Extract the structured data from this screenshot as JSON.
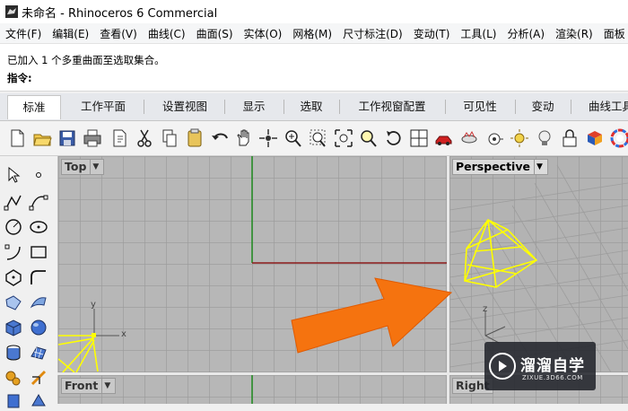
{
  "window": {
    "title": "未命名 - Rhinoceros 6 Commercial"
  },
  "menu": [
    "文件(F)",
    "编辑(E)",
    "查看(V)",
    "曲线(C)",
    "曲面(S)",
    "实体(O)",
    "网格(M)",
    "尺寸标注(D)",
    "变动(T)",
    "工具(L)",
    "分析(A)",
    "渲染(R)",
    "面板"
  ],
  "command": {
    "history_message": "已加入 1 个多重曲面至选取集合。",
    "prompt": "指令:"
  },
  "tabs": [
    "标准",
    "工作平面",
    "设置视图",
    "显示",
    "选取",
    "工作视窗配置",
    "可见性",
    "变动",
    "曲线工具"
  ],
  "viewports": {
    "top": "Top",
    "perspective": "Perspective",
    "front": "Front",
    "right": "Right"
  },
  "axes": {
    "x": "x",
    "y": "y",
    "z": "z"
  },
  "watermark": {
    "brand": "溜溜自学",
    "url": "ZIXUE.3D66.COM"
  },
  "colors": {
    "viewport_bg": "#b7b7b7",
    "grid_line": "#9b9b9b",
    "x_axis": "#8b1a1a",
    "y_axis": "#1f8b1f",
    "selection": "#ffff00",
    "arrow": "#f5730f"
  }
}
